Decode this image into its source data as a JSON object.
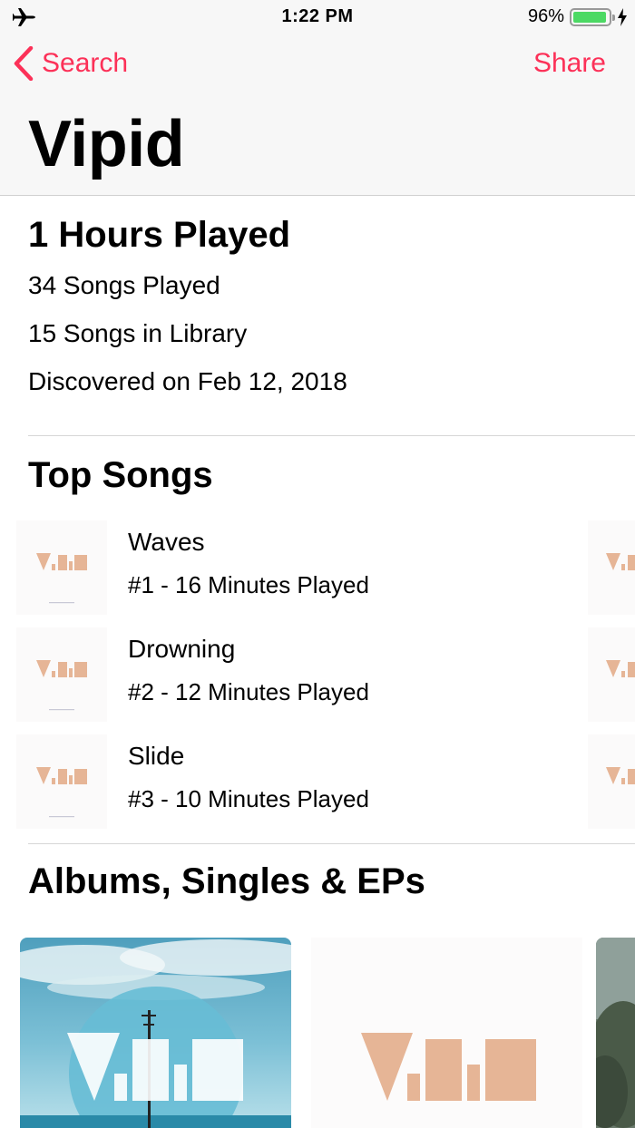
{
  "status_bar": {
    "time": "1:22 PM",
    "battery_percent": "96%",
    "battery_level": 0.96,
    "icons": [
      "airplane-icon",
      "battery-icon",
      "charging-bolt-icon"
    ]
  },
  "nav": {
    "back_label": "Search",
    "share_label": "Share",
    "title": "Vipid"
  },
  "stats": {
    "hours_played": "1 Hours Played",
    "songs_played": "34 Songs Played",
    "songs_in_library": "15 Songs in Library",
    "discovered": "Discovered on Feb 12, 2018"
  },
  "top_songs": {
    "heading": "Top Songs",
    "items": [
      {
        "title": "Waves",
        "detail": "#1 - 16 Minutes Played"
      },
      {
        "title": "Drowning",
        "detail": "#2 - 12 Minutes Played"
      },
      {
        "title": "Slide",
        "detail": "#3 - 10 Minutes Played"
      }
    ]
  },
  "albums": {
    "heading": "Albums, Singles & EPs"
  },
  "colors": {
    "accent": "#fc3158",
    "logo": "#e6b596",
    "battery_green": "#4cd964"
  }
}
